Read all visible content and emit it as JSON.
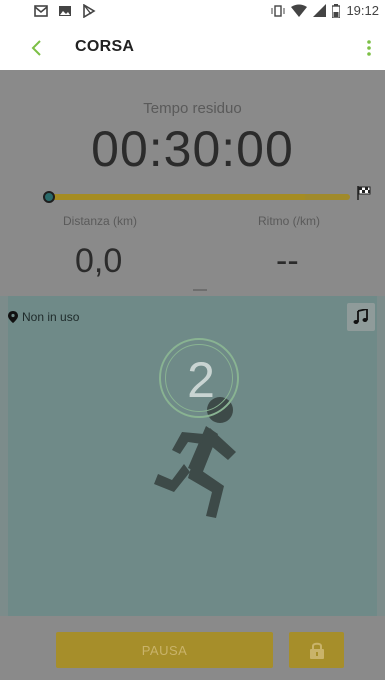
{
  "status_bar": {
    "time": "19:12",
    "left_icons": [
      "mail-icon",
      "image-icon",
      "play-store-icon"
    ],
    "right_icons": [
      "vibrate-icon",
      "wifi-icon",
      "signal-icon",
      "battery-icon"
    ]
  },
  "app_bar": {
    "title": "CORSA",
    "accent_color": "#7cbf45"
  },
  "stats": {
    "time_label": "Tempo residuo",
    "time_value": "00:30:00",
    "distance_label": "Distanza (km)",
    "distance_value": "0,0",
    "pace_label": "Ritmo (/km)",
    "pace_value": "--",
    "progress_track_color": "#a08a2b"
  },
  "map": {
    "location_status": "Non in uso",
    "countdown": "2"
  },
  "controls": {
    "pause_label": "PAUSA",
    "button_color": "#a68e2a"
  }
}
